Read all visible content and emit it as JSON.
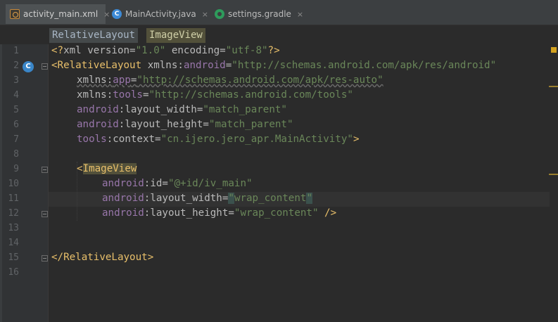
{
  "tabs": [
    {
      "label": "activity_main.xml",
      "icon": "xml-file-icon",
      "active": true
    },
    {
      "label": "MainActivity.java",
      "icon": "java-class-icon",
      "active": false
    },
    {
      "label": "settings.gradle",
      "icon": "gradle-file-icon",
      "active": false
    }
  ],
  "tab_close_glyph": "×",
  "breadcrumb": [
    "RelativeLayout",
    "ImageView"
  ],
  "gutter": {
    "line_numbers": [
      "1",
      "2",
      "3",
      "4",
      "5",
      "6",
      "7",
      "8",
      "9",
      "10",
      "11",
      "12",
      "13",
      "14",
      "15",
      "16"
    ],
    "class_icon_letter": "C"
  },
  "code": {
    "l1": {
      "a": "<?",
      "b": "xml version=",
      "c": "\"1.0\"",
      "d": " encoding=",
      "e": "\"utf-8\"",
      "f": "?>"
    },
    "l2": {
      "a": "<",
      "b": "RelativeLayout",
      "c": " ",
      "d": "xmlns:",
      "e": "android",
      "f": "=",
      "g": "\"http://schemas.android.com/apk/res/android\""
    },
    "l3": {
      "a": "xmlns:",
      "b": "app",
      "c": "=",
      "d": "\"http://schemas.android.com/apk/res-auto\""
    },
    "l4": {
      "a": "xmlns:",
      "b": "tools",
      "c": "=",
      "d": "\"http://schemas.android.com/tools\""
    },
    "l5": {
      "a": "android",
      "b": ":layout_width=",
      "c": "\"match_parent\""
    },
    "l6": {
      "a": "android",
      "b": ":layout_height=",
      "c": "\"match_parent\""
    },
    "l7": {
      "a": "tools",
      "b": ":context=",
      "c": "\"cn.ijero.jero_apr.MainActivity\"",
      "d": ">"
    },
    "l9": {
      "a": "<",
      "b": "ImageView"
    },
    "l10": {
      "a": "android",
      "b": ":id=",
      "c": "\"@+id/iv_main\""
    },
    "l11": {
      "a": "android",
      "b": ":layout_width=",
      "c": "\"",
      "d": "wrap_content",
      "e": "\""
    },
    "l12": {
      "a": "android",
      "b": ":layout_height=",
      "c": "\"wrap_content\"",
      "d": " />"
    },
    "l15": {
      "a": "</",
      "b": "RelativeLayout",
      "c": ">"
    }
  },
  "colors": {
    "background": "#2b2b2b",
    "gutter": "#313335",
    "tag": "#e8bf6a",
    "namespace": "#9876aa",
    "string": "#6a8759",
    "attribute": "#bababa",
    "warning_marker": "#d3a21f"
  }
}
